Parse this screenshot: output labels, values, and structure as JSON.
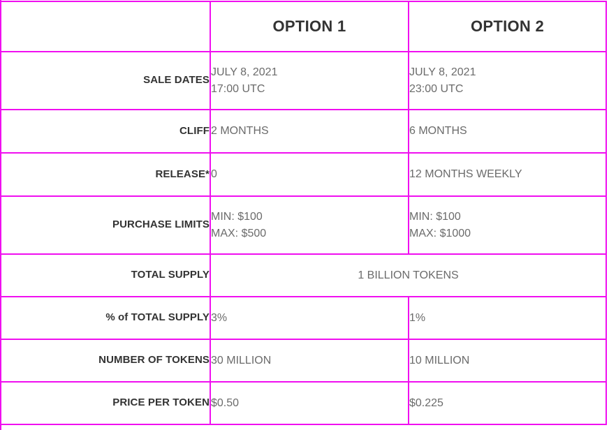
{
  "table": {
    "columns": [
      {
        "key": "label",
        "header": ""
      },
      {
        "key": "option1",
        "header": "OPTION 1"
      },
      {
        "key": "option2",
        "header": "OPTION 2"
      }
    ],
    "rows": [
      {
        "label": "SALE DATES",
        "option1_lines": [
          "JULY 8, 2021",
          "17:00 UTC"
        ],
        "option2_lines": [
          "JULY 8, 2021",
          "23:00 UTC"
        ],
        "merged": false
      },
      {
        "label": "CLIFF",
        "option1_lines": [
          "2 MONTHS"
        ],
        "option2_lines": [
          "6 MONTHS"
        ],
        "merged": false
      },
      {
        "label": "RELEASE*",
        "option1_lines": [
          "0"
        ],
        "option2_lines": [
          "12 MONTHS WEEKLY"
        ],
        "merged": false
      },
      {
        "label": "PURCHASE LIMITS",
        "option1_lines": [
          "MIN: $100",
          "MAX: $500"
        ],
        "option2_lines": [
          "MIN: $100",
          "MAX: $1000"
        ],
        "merged": false
      },
      {
        "label": "TOTAL SUPPLY",
        "merged": true,
        "merged_value": "1 BILLION TOKENS"
      },
      {
        "label": "% of TOTAL SUPPLY",
        "option1_lines": [
          "3%"
        ],
        "option2_lines": [
          "1%"
        ],
        "merged": false
      },
      {
        "label": "NUMBER OF TOKENS",
        "option1_lines": [
          "30 MILLION"
        ],
        "option2_lines": [
          "10 MILLION"
        ],
        "merged": false
      },
      {
        "label": "PRICE PER TOKEN",
        "option1_lines": [
          "$0.50"
        ],
        "option2_lines": [
          "$0.225"
        ],
        "merged": false
      }
    ]
  },
  "colors": {
    "border": "#f00ff0",
    "label_text": "#333333",
    "value_text": "#6b6b6b",
    "header_text": "#333333",
    "background": "#ffffff"
  }
}
